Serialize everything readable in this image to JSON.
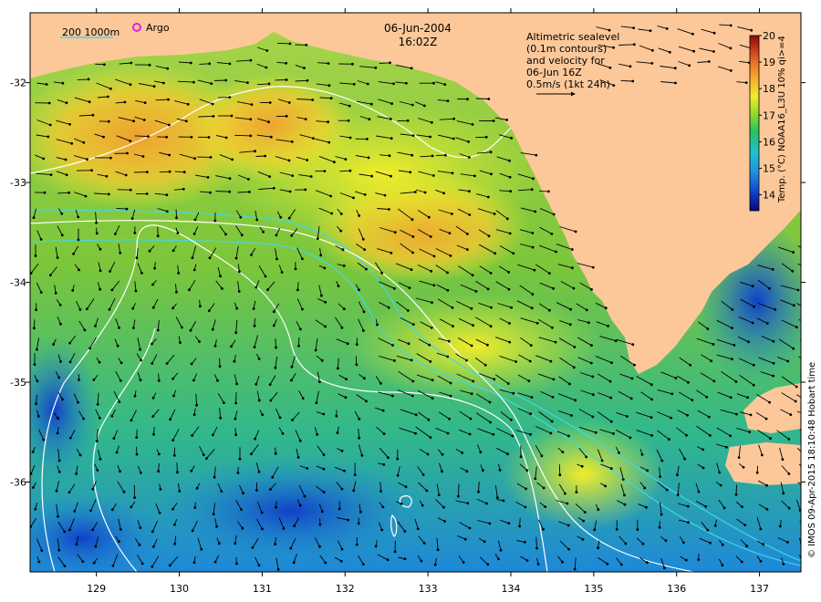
{
  "map": {
    "date": "06-Jun-2004",
    "time": "16:02Z",
    "depth_legend": "200  1000m",
    "argo_label": "Argo",
    "velocity_note": [
      "Altimetric sealevel",
      "(0.1m contours)",
      "and velocity for",
      "06-Jun 16Z",
      "0.5m/s (1kt 24h)"
    ],
    "credit": "© IMOS 09-Apr-2015 18:10:48 Hobart time",
    "x_ticks": [
      "129",
      "130",
      "131",
      "132",
      "133",
      "134",
      "135",
      "136",
      "137"
    ],
    "y_ticks": [
      "-32",
      "-33",
      "-34",
      "-35",
      "-36"
    ],
    "lon_range": [
      128.2,
      137.5
    ],
    "lat_range": [
      -36.9,
      -31.3
    ]
  },
  "colorbar": {
    "label": "Temp. (°C) NOAA16_L3U 10% qi>=4",
    "ticks": [
      "20",
      "19",
      "18",
      "17",
      "16",
      "15",
      "14"
    ],
    "range": [
      13.4,
      20
    ]
  },
  "colors": {
    "land": "#fcc89a",
    "white_contour": "#ffffff",
    "cyan_contour": "#40d8e8",
    "argo": "#e020e0"
  }
}
